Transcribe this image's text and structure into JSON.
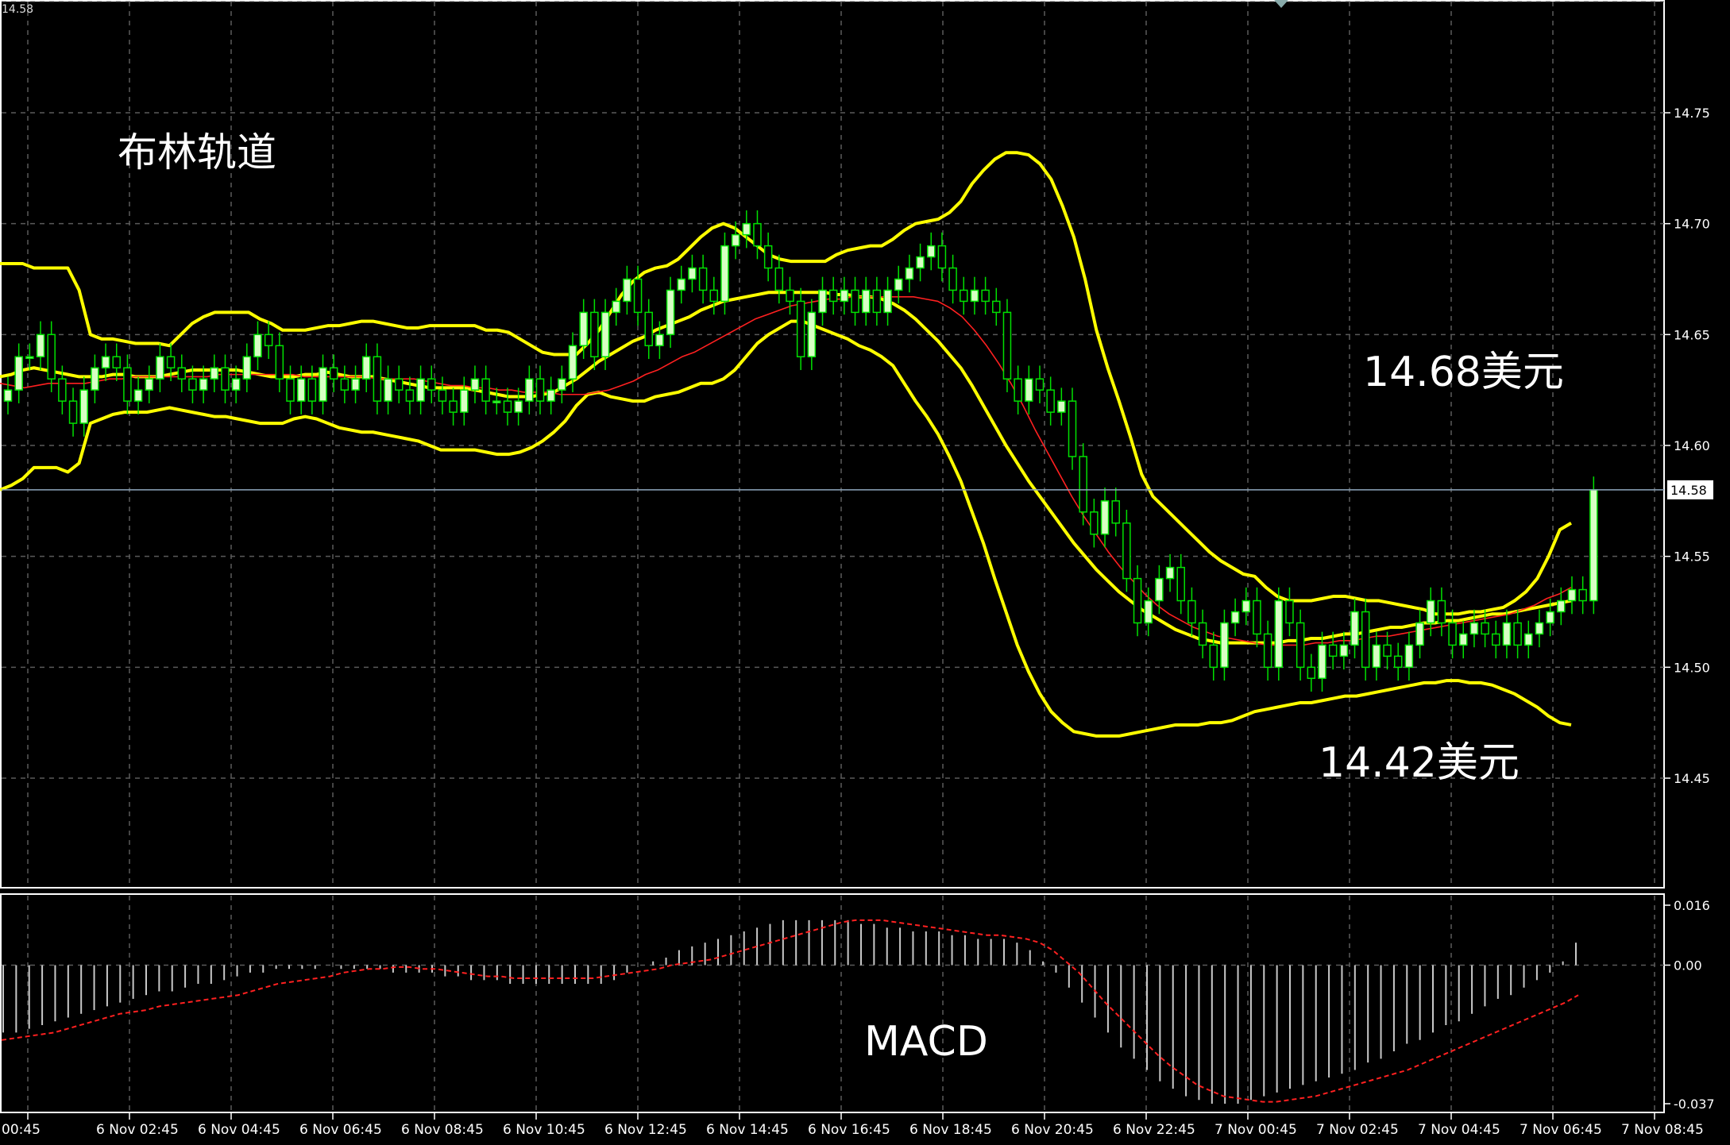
{
  "header": {
    "corner_price": "14.58"
  },
  "annotations": {
    "title": "布林轨道",
    "upper_level": "14.68美元",
    "lower_level": "14.42美元",
    "macd_label": "MACD"
  },
  "colors": {
    "background": "#000000",
    "grid": "#5a5a5a",
    "candle_bull_fill": "#d8ffc4",
    "candle_bear_fill": "#000000",
    "candle_outline": "#00e000",
    "bollinger": "#ffff00",
    "ma": "#ff2020",
    "macd_hist": "#c8c8c8",
    "macd_signal": "#ff2020",
    "current_price_line": "#8ea7bd",
    "axis_text": "#ffffff"
  },
  "chart_data": [
    {
      "type": "candlestick",
      "title": "布林轨道",
      "price_axis": {
        "ylim": [
          14.4,
          14.8
        ],
        "ticks": [
          "14.75",
          "14.70",
          "14.65",
          "14.60",
          "14.55",
          "14.50",
          "14.45"
        ]
      },
      "current_price": 14.58,
      "current_price_label": "14.58",
      "time_axis": {
        "ticks": [
          "00:45",
          "6 Nov 02:45",
          "6 Nov 04:45",
          "6 Nov 06:45",
          "6 Nov 08:45",
          "6 Nov 10:45",
          "6 Nov 12:45",
          "6 Nov 14:45",
          "6 Nov 16:45",
          "6 Nov 18:45",
          "6 Nov 20:45",
          "6 Nov 22:45",
          "7 Nov 00:45",
          "7 Nov 02:45",
          "7 Nov 04:45",
          "7 Nov 06:45",
          "7 Nov 08:45"
        ],
        "bars_per_tick": 8
      },
      "annotations": [
        "14.68美元",
        "14.42美元"
      ],
      "close": [
        14.625,
        14.64,
        14.64,
        14.65,
        14.63,
        14.62,
        14.61,
        14.625,
        14.635,
        14.64,
        14.635,
        14.62,
        14.625,
        14.63,
        14.64,
        14.635,
        14.63,
        14.625,
        14.63,
        14.635,
        14.625,
        14.63,
        14.64,
        14.65,
        14.645,
        14.63,
        14.62,
        14.63,
        14.62,
        14.635,
        14.63,
        14.625,
        14.63,
        14.64,
        14.62,
        14.63,
        14.625,
        14.62,
        14.63,
        14.625,
        14.62,
        14.615,
        14.625,
        14.63,
        14.62,
        14.62,
        14.615,
        14.62,
        14.63,
        14.62,
        14.625,
        14.63,
        14.645,
        14.66,
        14.64,
        14.66,
        14.665,
        14.675,
        14.66,
        14.645,
        14.65,
        14.67,
        14.675,
        14.68,
        14.67,
        14.665,
        14.69,
        14.695,
        14.7,
        14.69,
        14.68,
        14.67,
        14.665,
        14.64,
        14.66,
        14.67,
        14.665,
        14.67,
        14.66,
        14.67,
        14.66,
        14.67,
        14.675,
        14.68,
        14.685,
        14.69,
        14.68,
        14.67,
        14.665,
        14.67,
        14.665,
        14.66,
        14.63,
        14.62,
        14.63,
        14.625,
        14.615,
        14.62,
        14.595,
        14.57,
        14.56,
        14.575,
        14.565,
        14.54,
        14.52,
        14.53,
        14.54,
        14.545,
        14.53,
        14.52,
        14.51,
        14.5,
        14.52,
        14.525,
        14.53,
        14.515,
        14.5,
        14.53,
        14.52,
        14.5,
        14.495,
        14.51,
        14.505,
        14.51,
        14.525,
        14.5,
        14.51,
        14.505,
        14.5,
        14.51,
        14.52,
        14.53,
        14.52,
        14.51,
        14.515,
        14.52,
        14.515,
        14.51,
        14.52,
        14.51,
        14.515,
        14.52,
        14.525,
        14.53,
        14.535,
        14.53,
        14.58
      ],
      "upper_band": [
        14.682,
        14.682,
        14.682,
        14.68,
        14.68,
        14.68,
        14.68,
        14.67,
        14.65,
        14.648,
        14.648,
        14.647,
        14.646,
        14.646,
        14.646,
        14.645,
        14.65,
        14.655,
        14.658,
        14.66,
        14.66,
        14.66,
        14.66,
        14.657,
        14.655,
        14.652,
        14.652,
        14.652,
        14.653,
        14.654,
        14.654,
        14.655,
        14.656,
        14.656,
        14.655,
        14.654,
        14.653,
        14.653,
        14.654,
        14.654,
        14.654,
        14.654,
        14.654,
        14.652,
        14.652,
        14.651,
        14.648,
        14.645,
        14.642,
        14.641,
        14.641,
        14.641,
        14.646,
        14.652,
        14.66,
        14.668,
        14.674,
        14.678,
        14.68,
        14.681,
        14.684,
        14.689,
        14.694,
        14.698,
        14.7,
        14.698,
        14.694,
        14.69,
        14.686,
        14.684,
        14.683,
        14.683,
        14.683,
        14.683,
        14.686,
        14.688,
        14.689,
        14.69,
        14.69,
        14.693,
        14.697,
        14.7,
        14.701,
        14.702,
        14.705,
        14.71,
        14.718,
        14.724,
        14.729,
        14.732,
        14.732,
        14.731,
        14.727,
        14.72,
        14.708,
        14.694,
        14.675,
        14.652,
        14.635,
        14.62,
        14.604,
        14.587,
        14.577,
        14.572,
        14.567,
        14.562,
        14.557,
        14.552,
        14.548,
        14.545,
        14.542,
        14.541,
        14.536,
        14.532,
        14.53,
        14.53,
        14.53,
        14.531,
        14.532,
        14.532,
        14.531,
        14.53,
        14.53,
        14.529,
        14.528,
        14.527,
        14.526,
        14.524,
        14.524,
        14.524,
        14.525,
        14.525,
        14.526,
        14.527,
        14.53,
        14.534,
        14.54,
        14.55,
        14.562,
        14.565
      ],
      "middle_band": [
        14.631,
        14.632,
        14.634,
        14.635,
        14.634,
        14.633,
        14.632,
        14.631,
        14.631,
        14.631,
        14.632,
        14.632,
        14.631,
        14.631,
        14.631,
        14.632,
        14.633,
        14.634,
        14.634,
        14.634,
        14.634,
        14.634,
        14.633,
        14.632,
        14.631,
        14.631,
        14.631,
        14.632,
        14.632,
        14.633,
        14.632,
        14.631,
        14.631,
        14.631,
        14.63,
        14.629,
        14.628,
        14.627,
        14.626,
        14.626,
        14.626,
        14.626,
        14.625,
        14.624,
        14.623,
        14.622,
        14.622,
        14.622,
        14.623,
        14.624,
        14.627,
        14.63,
        14.634,
        14.638,
        14.641,
        14.644,
        14.647,
        14.649,
        14.652,
        14.654,
        14.656,
        14.658,
        14.661,
        14.663,
        14.665,
        14.666,
        14.667,
        14.668,
        14.669,
        14.669,
        14.669,
        14.669,
        14.669,
        14.669,
        14.668,
        14.668,
        14.667,
        14.667,
        14.666,
        14.664,
        14.661,
        14.657,
        14.652,
        14.647,
        14.641,
        14.635,
        14.627,
        14.618,
        14.609,
        14.6,
        14.592,
        14.584,
        14.577,
        14.57,
        14.563,
        14.556,
        14.55,
        14.544,
        14.539,
        14.534,
        14.53,
        14.526,
        14.523,
        14.52,
        14.517,
        14.515,
        14.513,
        14.512,
        14.511,
        14.511,
        14.511,
        14.511,
        14.511,
        14.511,
        14.512,
        14.512,
        14.513,
        14.513,
        14.514,
        14.515,
        14.515,
        14.516,
        14.517,
        14.518,
        14.518,
        14.519,
        14.52,
        14.52,
        14.521,
        14.521,
        14.522,
        14.523,
        14.524,
        14.524,
        14.525,
        14.526,
        14.527,
        14.528,
        14.529,
        14.53
      ],
      "lower_band": [
        14.58,
        14.582,
        14.585,
        14.59,
        14.59,
        14.59,
        14.588,
        14.592,
        14.61,
        14.612,
        14.614,
        14.615,
        14.615,
        14.615,
        14.616,
        14.617,
        14.616,
        14.615,
        14.614,
        14.613,
        14.613,
        14.612,
        14.611,
        14.61,
        14.61,
        14.61,
        14.612,
        14.613,
        14.612,
        14.61,
        14.608,
        14.607,
        14.606,
        14.606,
        14.605,
        14.604,
        14.603,
        14.602,
        14.6,
        14.598,
        14.598,
        14.598,
        14.598,
        14.597,
        14.596,
        14.596,
        14.597,
        14.599,
        14.602,
        14.606,
        14.611,
        14.618,
        14.623,
        14.624,
        14.622,
        14.621,
        14.62,
        14.62,
        14.622,
        14.623,
        14.624,
        14.626,
        14.628,
        14.628,
        14.63,
        14.634,
        14.64,
        14.646,
        14.65,
        14.653,
        14.656,
        14.656,
        14.654,
        14.652,
        14.65,
        14.648,
        14.645,
        14.643,
        14.64,
        14.636,
        14.628,
        14.62,
        14.613,
        14.605,
        14.595,
        14.584,
        14.57,
        14.556,
        14.54,
        14.525,
        14.51,
        14.498,
        14.488,
        14.48,
        14.475,
        14.471,
        14.47,
        14.469,
        14.469,
        14.469,
        14.47,
        14.471,
        14.472,
        14.473,
        14.474,
        14.474,
        14.474,
        14.475,
        14.475,
        14.476,
        14.478,
        14.48,
        14.481,
        14.482,
        14.483,
        14.484,
        14.484,
        14.485,
        14.486,
        14.487,
        14.487,
        14.488,
        14.489,
        14.49,
        14.491,
        14.492,
        14.493,
        14.493,
        14.494,
        14.494,
        14.493,
        14.493,
        14.492,
        14.49,
        14.488,
        14.485,
        14.482,
        14.478,
        14.475,
        14.474,
        14.474,
        14.474,
        14.474,
        14.474
      ],
      "ma": [
        14.628,
        14.627,
        14.626,
        14.627,
        14.628,
        14.628,
        14.628,
        14.628,
        14.629,
        14.63,
        14.63,
        14.631,
        14.631,
        14.631,
        14.631,
        14.631,
        14.631,
        14.631,
        14.632,
        14.632,
        14.632,
        14.632,
        14.632,
        14.632,
        14.632,
        14.631,
        14.631,
        14.631,
        14.631,
        14.631,
        14.631,
        14.63,
        14.63,
        14.63,
        14.63,
        14.629,
        14.628,
        14.627,
        14.627,
        14.626,
        14.626,
        14.625,
        14.625,
        14.624,
        14.624,
        14.624,
        14.623,
        14.623,
        14.623,
        14.624,
        14.625,
        14.627,
        14.629,
        14.632,
        14.634,
        14.637,
        14.64,
        14.642,
        14.645,
        14.648,
        14.651,
        14.654,
        14.657,
        14.659,
        14.661,
        14.663,
        14.664,
        14.665,
        14.666,
        14.666,
        14.667,
        14.667,
        14.667,
        14.667,
        14.667,
        14.667,
        14.666,
        14.665,
        14.662,
        14.658,
        14.652,
        14.645,
        14.637,
        14.628,
        14.618,
        14.607,
        14.597,
        14.587,
        14.577,
        14.568,
        14.56,
        14.552,
        14.545,
        14.539,
        14.533,
        14.528,
        14.524,
        14.521,
        14.518,
        14.516,
        14.514,
        14.513,
        14.512,
        14.511,
        14.51,
        14.51,
        14.51,
        14.51,
        14.511,
        14.511,
        14.512,
        14.512,
        14.513,
        14.514,
        14.514,
        14.515,
        14.516,
        14.517,
        14.518,
        14.519,
        14.52,
        14.521,
        14.522,
        14.523,
        14.524,
        14.526,
        14.528,
        14.531,
        14.533,
        14.536
      ],
      "ma_offset": 0
    },
    {
      "type": "bar",
      "title": "MACD",
      "value_axis": {
        "ylim": [
          -0.037,
          0.016
        ],
        "ticks": [
          "0.016",
          "0.00",
          "-0.037"
        ]
      },
      "histogram": [
        -0.018,
        -0.018,
        -0.017,
        -0.016,
        -0.015,
        -0.014,
        -0.013,
        -0.012,
        -0.011,
        -0.01,
        -0.009,
        -0.008,
        -0.007,
        -0.007,
        -0.006,
        -0.005,
        -0.005,
        -0.004,
        -0.003,
        -0.002,
        -0.002,
        -0.001,
        -0.001,
        -0.001,
        -0.001,
        0.0,
        -0.001,
        -0.001,
        -0.001,
        -0.001,
        -0.002,
        -0.002,
        -0.002,
        -0.002,
        -0.003,
        -0.003,
        -0.004,
        -0.004,
        -0.004,
        -0.005,
        -0.005,
        -0.005,
        -0.005,
        -0.005,
        -0.005,
        -0.005,
        -0.005,
        -0.004,
        -0.002,
        0.0,
        0.001,
        0.002,
        0.004,
        0.005,
        0.006,
        0.007,
        0.008,
        0.009,
        0.01,
        0.011,
        0.012,
        0.012,
        0.012,
        0.012,
        0.012,
        0.012,
        0.011,
        0.011,
        0.01,
        0.01,
        0.009,
        0.009,
        0.009,
        0.008,
        0.008,
        0.007,
        0.007,
        0.007,
        0.006,
        0.004,
        0.001,
        -0.002,
        -0.006,
        -0.01,
        -0.014,
        -0.018,
        -0.022,
        -0.025,
        -0.028,
        -0.031,
        -0.033,
        -0.035,
        -0.036,
        -0.037,
        -0.037,
        -0.037,
        -0.036,
        -0.035,
        -0.034,
        -0.033,
        -0.032,
        -0.031,
        -0.03,
        -0.029,
        -0.028,
        -0.026,
        -0.025,
        -0.023,
        -0.021,
        -0.02,
        -0.018,
        -0.016,
        -0.015,
        -0.013,
        -0.011,
        -0.009,
        -0.008,
        -0.006,
        -0.004,
        -0.002,
        0.001,
        0.006
      ],
      "signal": [
        -0.02,
        -0.0195,
        -0.019,
        -0.0185,
        -0.018,
        -0.017,
        -0.016,
        -0.015,
        -0.014,
        -0.013,
        -0.0125,
        -0.012,
        -0.011,
        -0.0105,
        -0.01,
        -0.0095,
        -0.009,
        -0.0085,
        -0.008,
        -0.007,
        -0.006,
        -0.005,
        -0.0045,
        -0.004,
        -0.0035,
        -0.003,
        -0.002,
        -0.0015,
        -0.001,
        -0.001,
        -0.0005,
        -0.0005,
        -0.001,
        -0.001,
        -0.0015,
        -0.002,
        -0.0025,
        -0.003,
        -0.003,
        -0.0035,
        -0.0035,
        -0.0035,
        -0.0035,
        -0.0035,
        -0.0035,
        -0.0035,
        -0.003,
        -0.0025,
        -0.002,
        -0.0015,
        -0.001,
        0.0,
        0.0005,
        0.001,
        0.0015,
        0.0025,
        0.0035,
        0.0045,
        0.0055,
        0.0065,
        0.0075,
        0.0085,
        0.0095,
        0.0105,
        0.0115,
        0.012,
        0.012,
        0.012,
        0.0115,
        0.011,
        0.0105,
        0.01,
        0.0095,
        0.009,
        0.0085,
        0.008,
        0.008,
        0.0075,
        0.007,
        0.006,
        0.004,
        0.001,
        -0.002,
        -0.006,
        -0.01,
        -0.0135,
        -0.017,
        -0.0205,
        -0.024,
        -0.027,
        -0.0295,
        -0.032,
        -0.0335,
        -0.035,
        -0.0355,
        -0.036,
        -0.0365,
        -0.0365,
        -0.036,
        -0.0355,
        -0.035,
        -0.034,
        -0.033,
        -0.032,
        -0.031,
        -0.03,
        -0.029,
        -0.028,
        -0.0265,
        -0.025,
        -0.0235,
        -0.022,
        -0.0205,
        -0.019,
        -0.0175,
        -0.016,
        -0.0145,
        -0.013,
        -0.0115,
        -0.01,
        -0.008
      ]
    }
  ]
}
